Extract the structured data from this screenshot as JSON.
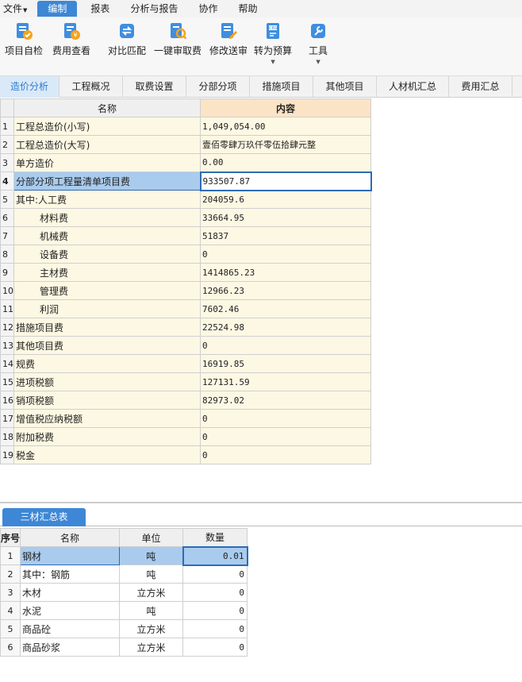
{
  "menu": {
    "file": "文件",
    "items": [
      "编制",
      "报表",
      "分析与报告",
      "协作",
      "帮助"
    ]
  },
  "ribbon": {
    "buttons": [
      {
        "label": "项目自检",
        "icon": "project-check-icon"
      },
      {
        "label": "费用查看",
        "icon": "fee-view-icon"
      },
      {
        "label": "对比匹配",
        "icon": "compare-match-icon"
      },
      {
        "label": "一键审取费",
        "icon": "one-click-review-icon"
      },
      {
        "label": "修改送审",
        "icon": "edit-submit-icon"
      },
      {
        "label": "转为预算",
        "icon": "convert-budget-icon"
      },
      {
        "label": "工具",
        "icon": "tools-icon"
      }
    ]
  },
  "tabs": [
    "造价分析",
    "工程概况",
    "取费设置",
    "分部分项",
    "措施项目",
    "其他项目",
    "人材机汇总",
    "费用汇总"
  ],
  "main_table": {
    "headers": {
      "name": "名称",
      "content": "内容"
    },
    "rows": [
      {
        "no": "1",
        "name": "工程总造价(小写)",
        "value": "1,049,054.00"
      },
      {
        "no": "2",
        "name": "工程总造价(大写)",
        "value": "壹佰零肆万玖仟零伍拾肆元整"
      },
      {
        "no": "3",
        "name": "单方造价",
        "value": "0.00"
      },
      {
        "no": "4",
        "name": "分部分项工程量清单项目费",
        "value": "933507.87"
      },
      {
        "no": "5",
        "name": "其中:人工费",
        "value": "204059.6"
      },
      {
        "no": "6",
        "name": "材料费",
        "value": "33664.95"
      },
      {
        "no": "7",
        "name": "机械费",
        "value": "51837"
      },
      {
        "no": "8",
        "name": "设备费",
        "value": "0"
      },
      {
        "no": "9",
        "name": "主材费",
        "value": "1414865.23"
      },
      {
        "no": "10",
        "name": "管理费",
        "value": "12966.23"
      },
      {
        "no": "11",
        "name": "利润",
        "value": "7602.46"
      },
      {
        "no": "12",
        "name": "措施项目费",
        "value": "22524.98"
      },
      {
        "no": "13",
        "name": "其他项目费",
        "value": "0"
      },
      {
        "no": "14",
        "name": "规费",
        "value": "16919.85"
      },
      {
        "no": "15",
        "name": "进项税额",
        "value": "127131.59"
      },
      {
        "no": "16",
        "name": "销项税额",
        "value": "82973.02"
      },
      {
        "no": "17",
        "name": "增值税应纳税额",
        "value": "0"
      },
      {
        "no": "18",
        "name": "附加税费",
        "value": "0"
      },
      {
        "no": "19",
        "name": "税金",
        "value": "0"
      }
    ]
  },
  "bottom_tab": "三材汇总表",
  "materials_table": {
    "headers": {
      "seq": "序号",
      "name": "名称",
      "unit": "单位",
      "qty": "数量"
    },
    "rows": [
      {
        "no": "1",
        "name": "钢材",
        "unit": "吨",
        "qty": "0.01"
      },
      {
        "no": "2",
        "name": "其中：钢筋",
        "unit": "吨",
        "qty": "0"
      },
      {
        "no": "3",
        "name": "木材",
        "unit": "立方米",
        "qty": "0"
      },
      {
        "no": "4",
        "name": "水泥",
        "unit": "吨",
        "qty": "0"
      },
      {
        "no": "5",
        "name": "商品砼",
        "unit": "立方米",
        "qty": "0"
      },
      {
        "no": "6",
        "name": "商品砂浆",
        "unit": "立方米",
        "qty": "0"
      }
    ]
  },
  "colors": {
    "accent": "#3d87d6",
    "selection": "#a9cbee",
    "cell_bg": "#fdf8e3",
    "header_highlight": "#fbe3c6"
  }
}
